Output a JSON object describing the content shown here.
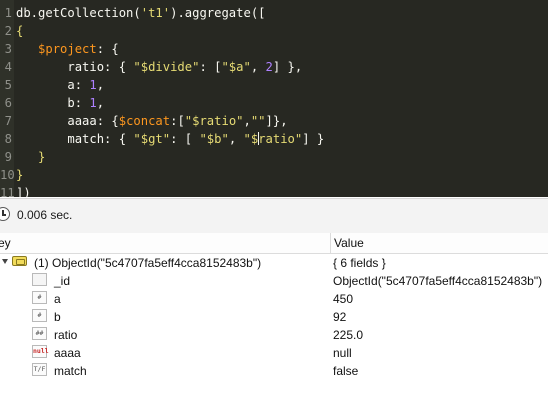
{
  "editor": {
    "lines": [
      {
        "n": "1",
        "segs": [
          [
            "db.getCollection(",
            "t-plain"
          ],
          [
            "'t1'",
            "t-yellow"
          ],
          [
            ").aggregate([",
            "t-plain"
          ]
        ]
      },
      {
        "n": "2",
        "segs": [
          [
            "{",
            "t-brack"
          ]
        ]
      },
      {
        "n": "3",
        "segs": [
          [
            "   ",
            "t-plain"
          ],
          [
            "$project",
            "t-orange"
          ],
          [
            ": {",
            "t-plain"
          ]
        ]
      },
      {
        "n": "4",
        "segs": [
          [
            "       ratio: { ",
            "t-plain"
          ],
          [
            "\"$divide\"",
            "t-yellow"
          ],
          [
            ": [",
            "t-plain"
          ],
          [
            "\"$a\"",
            "t-yellow"
          ],
          [
            ", ",
            "t-plain"
          ],
          [
            "2",
            "t-purple"
          ],
          [
            "] },",
            "t-plain"
          ]
        ]
      },
      {
        "n": "5",
        "segs": [
          [
            "       a: ",
            "t-plain"
          ],
          [
            "1",
            "t-purple"
          ],
          [
            ",",
            "t-plain"
          ]
        ]
      },
      {
        "n": "6",
        "segs": [
          [
            "       b: ",
            "t-plain"
          ],
          [
            "1",
            "t-purple"
          ],
          [
            ",",
            "t-plain"
          ]
        ]
      },
      {
        "n": "7",
        "segs": [
          [
            "       aaaa: {",
            "t-plain"
          ],
          [
            "$concat",
            "t-orange"
          ],
          [
            ":[",
            "t-plain"
          ],
          [
            "\"$ratio\"",
            "t-yellow"
          ],
          [
            ",",
            "t-plain"
          ],
          [
            "\"\"",
            "t-yellow"
          ],
          [
            "]},",
            "t-plain"
          ]
        ]
      },
      {
        "n": "8",
        "segs": [
          [
            "       match: { ",
            "t-plain"
          ],
          [
            "\"$gt\"",
            "t-yellow"
          ],
          [
            ": [ ",
            "t-plain"
          ],
          [
            "\"$b\"",
            "t-yellow"
          ],
          [
            ", ",
            "t-plain"
          ],
          [
            "\"$",
            "t-yellow"
          ],
          [
            "|",
            "cursor"
          ],
          [
            "ratio\"",
            "t-yellow"
          ],
          [
            "] }",
            "t-plain"
          ]
        ]
      },
      {
        "n": "9",
        "segs": [
          [
            "   }",
            "t-brack"
          ]
        ]
      },
      {
        "n": "10",
        "segs": [
          [
            "}",
            "t-brack"
          ]
        ]
      },
      {
        "n": "11",
        "segs": [
          [
            "])",
            "t-plain"
          ]
        ]
      }
    ]
  },
  "status": {
    "elapsed": "0.006 sec."
  },
  "table": {
    "header_key": "ey",
    "header_value": "Value",
    "root": {
      "label": "(1) ObjectId(\"5c4707fa5eff4cca8152483b\")",
      "value": "{ 6 fields }"
    },
    "fields": [
      {
        "icon": "",
        "key": "_id",
        "value": "ObjectId(\"5c4707fa5eff4cca8152483b\")",
        "icon_name": "objectid-icon"
      },
      {
        "icon": "#",
        "key": "a",
        "value": "450",
        "icon_name": "int-icon"
      },
      {
        "icon": "#",
        "key": "b",
        "value": "92",
        "icon_name": "int-icon"
      },
      {
        "icon": "##",
        "key": "ratio",
        "value": "225.0",
        "icon_name": "double-icon"
      },
      {
        "icon": "null",
        "key": "aaaa",
        "value": "null",
        "icon_name": "null-icon"
      },
      {
        "icon": "T/F",
        "key": "match",
        "value": "false",
        "icon_name": "boolean-icon"
      }
    ]
  },
  "colors": {
    "editor_bg": "#272822",
    "keyword": "#fd971f",
    "string": "#e6db74",
    "number": "#ae81ff"
  }
}
